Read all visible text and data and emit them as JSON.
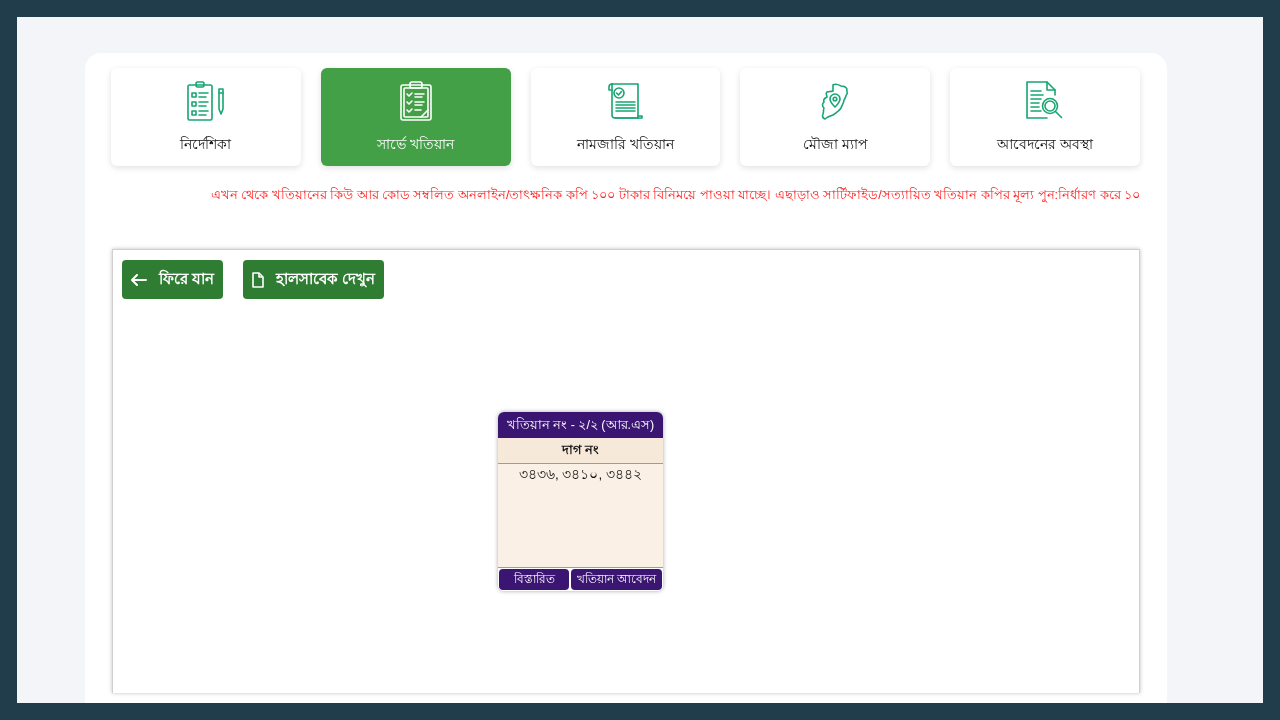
{
  "tiles": [
    {
      "label": "নির্দেশিকা",
      "kind": "checklist",
      "selected": false
    },
    {
      "label": "সার্ভে খতিয়ান",
      "kind": "clipboard",
      "selected": true
    },
    {
      "label": "নামজারি খতিয়ান",
      "kind": "scroll",
      "selected": false
    },
    {
      "label": "মৌজা ম্যাপ",
      "kind": "map",
      "selected": false
    },
    {
      "label": "আবেদনের অবস্থা",
      "kind": "search",
      "selected": false
    }
  ],
  "notice": "এখন থেকে খতিয়ানের কিউ আর কোড সম্বলিত অনলাইন/তাৎক্ষনিক কপি ১০০ টাকার বিনিময়ে পাওয়া যাচ্ছে। এছাড়াও সার্টিফাইড/সত্যায়িত খতিয়ান কপির মূল্য পুন:নির্ধারণ করে ১০",
  "buttons": [
    {
      "label": "ফিরে যান",
      "kind": "back"
    },
    {
      "label": "হালসাবেক দেখুন",
      "kind": "document"
    }
  ],
  "khatian_card": {
    "title": "খতিয়ান নং - ২/২ (আর.এস)",
    "dag_label": "দাগ নং",
    "dag_numbers": "৩৪৩৬, ৩৪১০, ৩৪৪২",
    "actions": [
      "বিস্তারিত",
      "খতিয়ান আবেদন"
    ]
  }
}
